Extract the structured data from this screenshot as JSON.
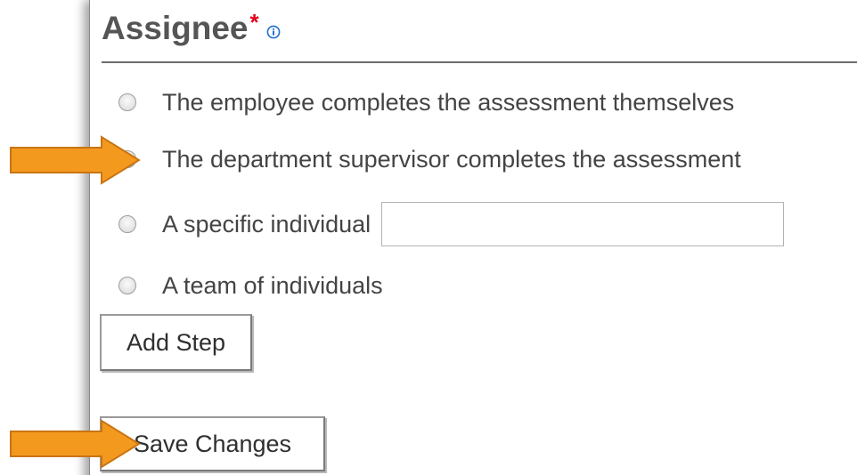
{
  "section": {
    "title": "Assignee",
    "required_marker": "*",
    "info_icon": "info-icon"
  },
  "options": [
    {
      "label": "The employee completes the assessment themselves",
      "checked": false
    },
    {
      "label": "The department supervisor completes the assessment",
      "checked": true
    },
    {
      "label": "A specific individual",
      "checked": false,
      "input_value": ""
    },
    {
      "label": "A team of individuals",
      "checked": false
    }
  ],
  "buttons": {
    "add_step": "Add Step",
    "save_changes": "Save Changes"
  },
  "colors": {
    "arrow": "#f39a1e",
    "required": "#e2001a",
    "info": "#1e6fd0"
  }
}
